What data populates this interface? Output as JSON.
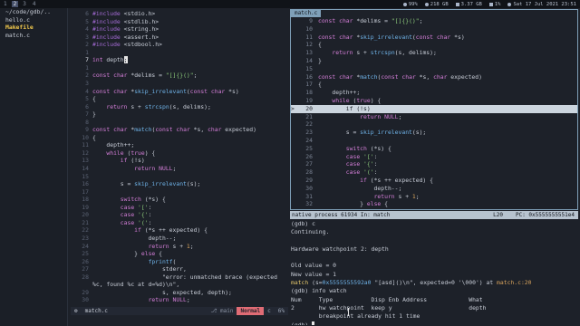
{
  "topbar": {
    "workspaces": [
      "1",
      "2",
      "3",
      "4"
    ],
    "active_workspace": "2",
    "sysinfo": {
      "battery": "99%",
      "memory": "218 GB",
      "disk": "3.37 GB",
      "cpu": "1%",
      "datetime": "Sat 17 Jul 2021 23:51"
    }
  },
  "tree": {
    "path": "~/code/gdb/..",
    "files": [
      {
        "name": "hello.c",
        "highlight": false
      },
      {
        "name": "Makefile",
        "highlight": true
      },
      {
        "name": "match.c",
        "highlight": false
      }
    ]
  },
  "editor": {
    "lines": [
      {
        "num": "6",
        "text": "#include <stdio.h>"
      },
      {
        "num": "5",
        "text": "#include <stdlib.h>"
      },
      {
        "num": "4",
        "text": "#include <string.h>"
      },
      {
        "num": "3",
        "text": "#include <assert.h>"
      },
      {
        "num": "2",
        "text": "#include <stdbool.h>"
      },
      {
        "num": "1",
        "text": ""
      },
      {
        "num": "7",
        "text": "int depth;",
        "current": true
      },
      {
        "num": "1",
        "text": ""
      },
      {
        "num": "2",
        "text": "const char *delims = \"[]{}()\";"
      },
      {
        "num": "3",
        "text": ""
      },
      {
        "num": "4",
        "text": "const char *skip_irrelevant(const char *s)"
      },
      {
        "num": "5",
        "text": "{"
      },
      {
        "num": "6",
        "text": "    return s + strcspn(s, delims);"
      },
      {
        "num": "7",
        "text": "}"
      },
      {
        "num": "8",
        "text": ""
      },
      {
        "num": "9",
        "text": "const char *match(const char *s, char expected)"
      },
      {
        "num": "10",
        "text": "{"
      },
      {
        "num": "11",
        "text": "    depth++;"
      },
      {
        "num": "12",
        "text": "    while (true) {"
      },
      {
        "num": "13",
        "text": "        if (!s)"
      },
      {
        "num": "14",
        "text": "            return NULL;"
      },
      {
        "num": "15",
        "text": ""
      },
      {
        "num": "16",
        "text": "        s = skip_irrelevant(s);"
      },
      {
        "num": "17",
        "text": ""
      },
      {
        "num": "18",
        "text": "        switch (*s) {"
      },
      {
        "num": "19",
        "text": "        case '[':"
      },
      {
        "num": "20",
        "text": "        case '{':"
      },
      {
        "num": "21",
        "text": "        case '(':"
      },
      {
        "num": "22",
        "text": "            if (*s ++ expected) {"
      },
      {
        "num": "23",
        "text": "                depth--;"
      },
      {
        "num": "24",
        "text": "                return s + 1;"
      },
      {
        "num": "25",
        "text": "            } else {"
      },
      {
        "num": "26",
        "text": "                fprintf("
      },
      {
        "num": "27",
        "text": "                    stderr,"
      },
      {
        "num": "28",
        "text": "                    \"error: unmatched brace (expected"
      },
      {
        "num": "",
        "text": "%c, found %c at d=%d)\\n\","
      },
      {
        "num": "29",
        "text": "                    s, expected, depth);"
      },
      {
        "num": "30",
        "text": "                return NULL;"
      }
    ]
  },
  "vimstatus": {
    "file": "match.c",
    "branch": "main",
    "mode": "Normal",
    "filetype": "c",
    "percent": "6%"
  },
  "srcwin": {
    "title": "match.c",
    "lines": [
      {
        "num": "9",
        "text": "const char *delims = \"[]{}()\";"
      },
      {
        "num": "10",
        "text": ""
      },
      {
        "num": "11",
        "text": "const char *skip_irrelevant(const char *s)"
      },
      {
        "num": "12",
        "text": "{"
      },
      {
        "num": "13",
        "text": "    return s + strcspn(s, delims);"
      },
      {
        "num": "14",
        "text": "}"
      },
      {
        "num": "15",
        "text": ""
      },
      {
        "num": "16",
        "text": "const char *match(const char *s, char expected)"
      },
      {
        "num": "17",
        "text": "{"
      },
      {
        "num": "18",
        "text": "    depth++;"
      },
      {
        "num": "19",
        "text": "    while (true) {"
      },
      {
        "num": "20",
        "text": "        if (!s)",
        "exec": true,
        "mark": ">"
      },
      {
        "num": "21",
        "text": "            return NULL;"
      },
      {
        "num": "22",
        "text": ""
      },
      {
        "num": "23",
        "text": "        s = skip_irrelevant(s);"
      },
      {
        "num": "24",
        "text": ""
      },
      {
        "num": "25",
        "text": "        switch (*s) {"
      },
      {
        "num": "26",
        "text": "        case '[':"
      },
      {
        "num": "27",
        "text": "        case '{':"
      },
      {
        "num": "28",
        "text": "        case '(':"
      },
      {
        "num": "29",
        "text": "            if (*s ++ expected) {"
      },
      {
        "num": "30",
        "text": "                depth--;"
      },
      {
        "num": "31",
        "text": "                return s + 1;"
      },
      {
        "num": "32",
        "text": "            } else {"
      }
    ]
  },
  "gdbstatus": {
    "process": "native process 61934 In: match",
    "line": "L20",
    "pc": "PC: 0x5555555551e4"
  },
  "console": {
    "lines": [
      "(gdb) c",
      "Continuing.",
      "",
      "Hardware watchpoint 2: depth",
      "",
      "Old value = 0",
      "New value = 1",
      "match (s=0x5555555592a0 \"[asd]()\\n\", expected=0 '\\000') at match.c:20",
      "(gdb) info watch",
      "Num     Type           Disp Enb Address            What",
      "2       hw watchpoint  keep y                      depth",
      "        breakpoint already hit 1 time",
      "(gdb) "
    ]
  }
}
